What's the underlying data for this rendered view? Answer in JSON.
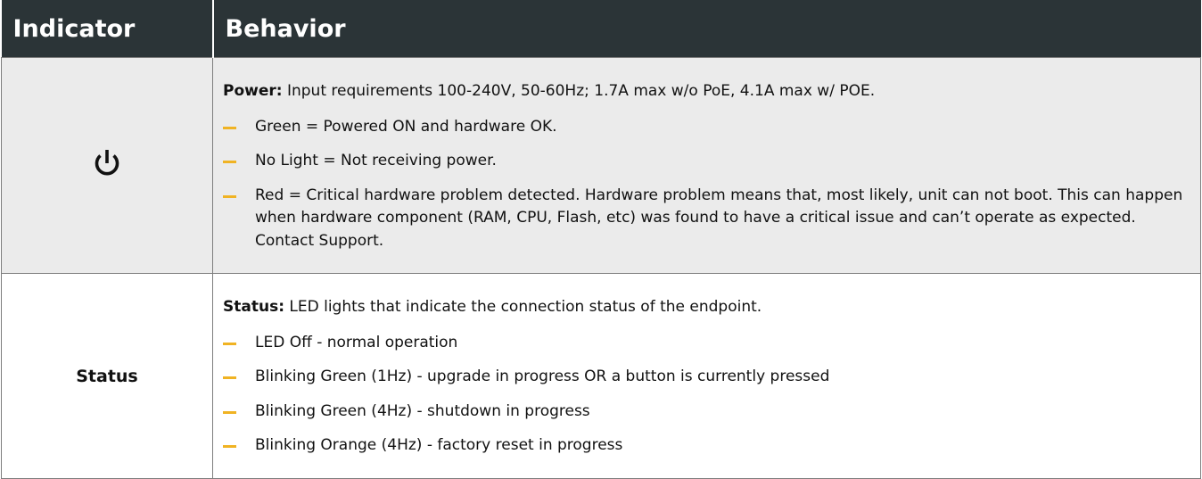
{
  "header": {
    "col1": "Indicator",
    "col2": "Behavior"
  },
  "accent_color": "#f0b323",
  "header_color": "#2b3437",
  "rows": [
    {
      "indicator_icon": "power-icon",
      "lead_label": "Power:",
      "lead_text": " Input requirements 100-240V, 50-60Hz; 1.7A max w/o PoE, 4.1A max w/ POE.",
      "items": [
        "Green = Powered ON and hardware OK.",
        "No Light = Not receiving power.",
        "Red = Critical hardware problem detected. Hardware problem means that, most likely, unit can not boot. This can happen when hardware component (RAM, CPU, Flash, etc) was found to have a critical issue and can’t operate as expected. Contact Support."
      ]
    },
    {
      "indicator_label": "Status",
      "lead_label": "Status:",
      "lead_text": " LED lights that indicate the connection status of the endpoint.",
      "items": [
        "LED Off - normal operation",
        "Blinking Green (1Hz) - upgrade in progress OR a button is currently pressed",
        "Blinking Green (4Hz) - shutdown in progress",
        "Blinking Orange (4Hz) - factory reset in progress"
      ]
    }
  ]
}
